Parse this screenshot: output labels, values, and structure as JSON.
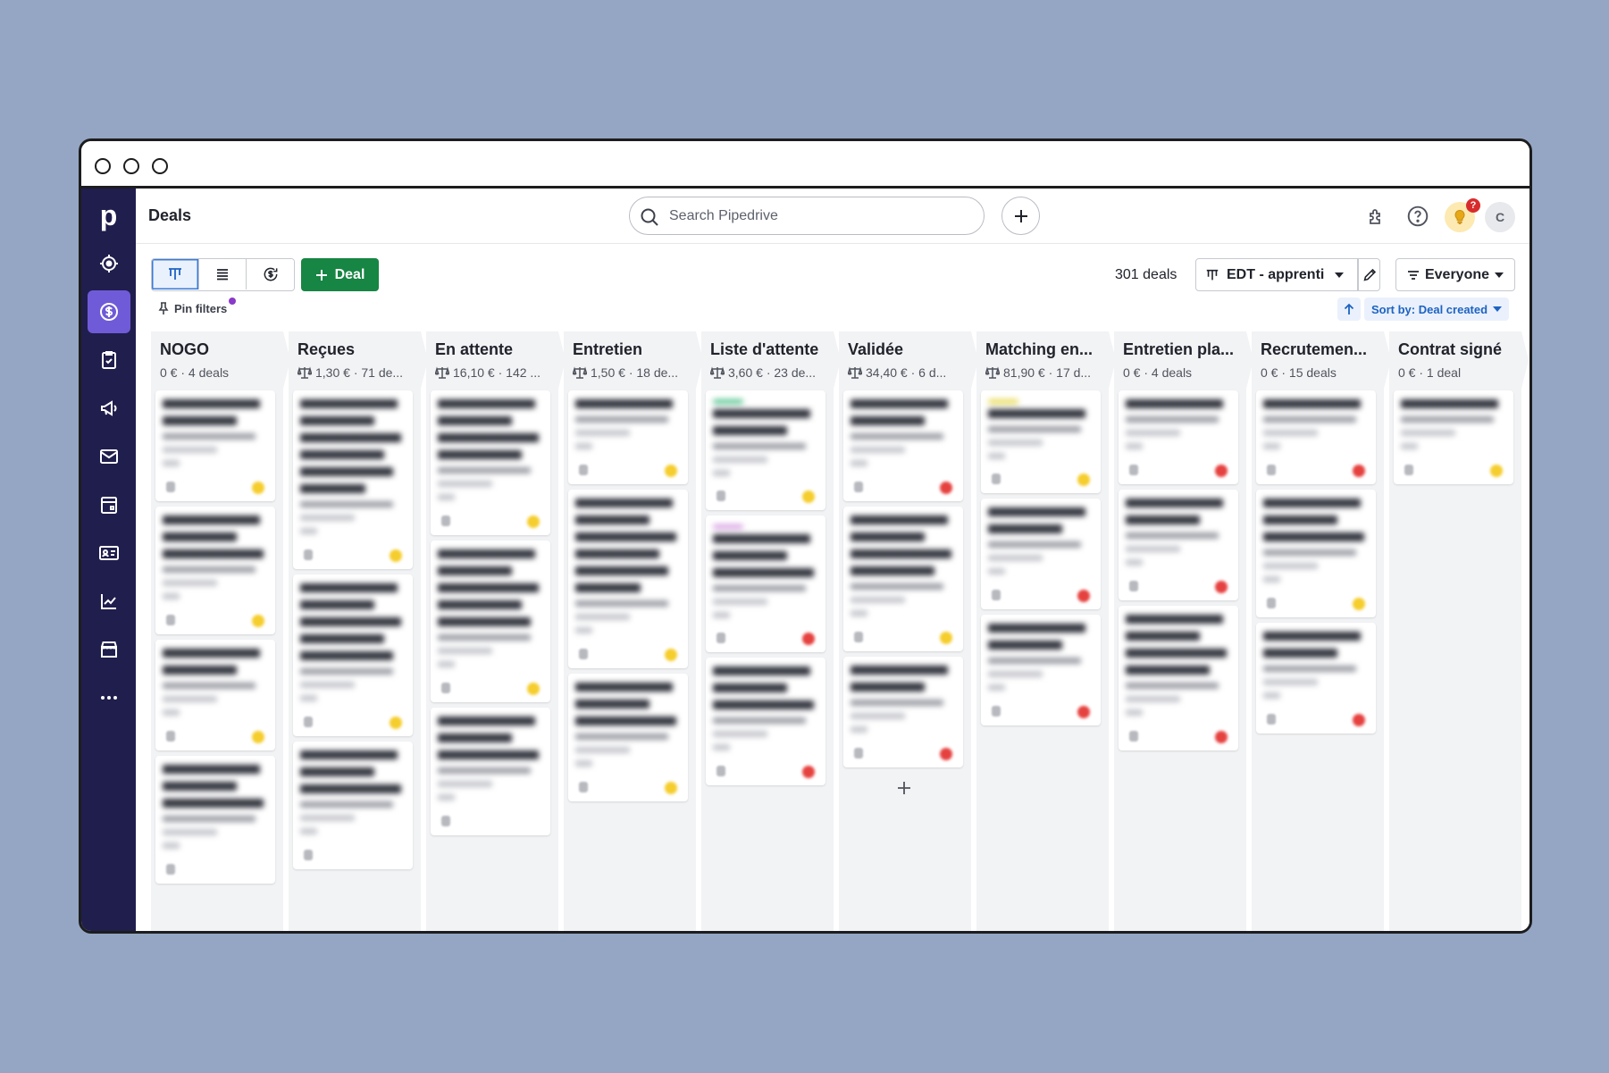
{
  "header": {
    "title": "Deals"
  },
  "search": {
    "placeholder": "Search Pipedrive"
  },
  "notifications": {
    "badge": "?"
  },
  "user": {
    "initial": "C"
  },
  "toolbar": {
    "deal_button": "Deal",
    "deal_count": "301 deals",
    "pipeline": "EDT - apprenti",
    "owner_filter": "Everyone"
  },
  "subbar": {
    "pin_filters": "Pin filters",
    "sort": "Sort by: Deal created"
  },
  "colors": {
    "sidebar": "#201e4d",
    "active_nav": "#6f5bd8",
    "deal_button": "#178543",
    "sort_text": "#1d63c2"
  },
  "icons": [
    "focus-icon",
    "dollar-icon",
    "tasks-icon",
    "megaphone-icon",
    "mail-icon",
    "calendar-icon",
    "contacts-icon",
    "chart-icon",
    "marketplace-icon",
    "more-icon"
  ],
  "columns": [
    {
      "title": "NOGO",
      "summary": "0 € · 4 deals",
      "weighted": false,
      "cards": [
        {
          "lines": 2,
          "status": "yellow"
        },
        {
          "lines": 3,
          "status": "yellow"
        },
        {
          "lines": 2,
          "status": "yellow"
        },
        {
          "lines": 3,
          "status": "none"
        }
      ]
    },
    {
      "title": "Reçues",
      "summary": "1,30 € · 71 de...",
      "weighted": true,
      "cards": [
        {
          "lines": 6,
          "status": "yellow"
        },
        {
          "lines": 5,
          "status": "yellow"
        },
        {
          "lines": 3,
          "status": "none"
        }
      ]
    },
    {
      "title": "En attente",
      "summary": "16,10 € · 142 ...",
      "weighted": true,
      "cards": [
        {
          "lines": 4,
          "status": "yellow"
        },
        {
          "lines": 5,
          "status": "yellow"
        },
        {
          "lines": 3,
          "status": "none"
        }
      ]
    },
    {
      "title": "Entretien",
      "summary": "1,50 € · 18 de...",
      "weighted": true,
      "cards": [
        {
          "lines": 1,
          "status": "yellow"
        },
        {
          "lines": 6,
          "status": "yellow"
        },
        {
          "lines": 3,
          "status": "yellow"
        }
      ]
    },
    {
      "title": "Liste d'attente",
      "summary": "3,60 € · 23 de...",
      "weighted": true,
      "cards": [
        {
          "lines": 2,
          "status": "yellow",
          "tag": "#4ec28a"
        },
        {
          "lines": 3,
          "status": "red",
          "tag": "#d69be0"
        },
        {
          "lines": 3,
          "status": "red"
        }
      ]
    },
    {
      "title": "Validée",
      "summary": "34,40 € · 6 d...",
      "weighted": true,
      "cards": [
        {
          "lines": 2,
          "status": "red"
        },
        {
          "lines": 4,
          "status": "yellow"
        },
        {
          "lines": 2,
          "status": "red"
        }
      ]
    },
    {
      "title": "Matching en...",
      "summary": "81,90 € · 17 d...",
      "weighted": true,
      "cards": [
        {
          "lines": 1,
          "status": "yellow",
          "tag": "#e8d84a"
        },
        {
          "lines": 2,
          "status": "red"
        },
        {
          "lines": 2,
          "status": "red"
        }
      ]
    },
    {
      "title": "Entretien pla...",
      "summary": "0 € · 4 deals",
      "weighted": false,
      "cards": [
        {
          "lines": 1,
          "status": "red"
        },
        {
          "lines": 2,
          "status": "red"
        },
        {
          "lines": 4,
          "status": "red"
        }
      ]
    },
    {
      "title": "Recrutemen...",
      "summary": "0 € · 15 deals",
      "weighted": false,
      "cards": [
        {
          "lines": 1,
          "status": "red"
        },
        {
          "lines": 3,
          "status": "yellow"
        },
        {
          "lines": 2,
          "status": "red"
        }
      ]
    },
    {
      "title": "Contrat signé",
      "summary": "0 € · 1 deal",
      "weighted": false,
      "cards": [
        {
          "lines": 1,
          "status": "yellow"
        }
      ]
    }
  ]
}
